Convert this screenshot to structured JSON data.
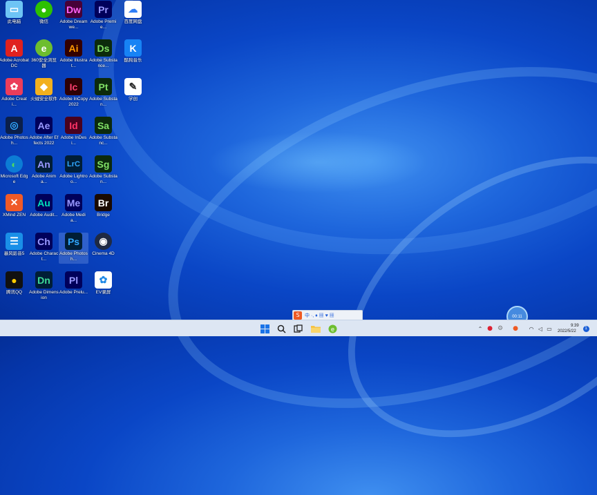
{
  "desktop_icons": [
    {
      "label": "此电脑",
      "glyph": "▭",
      "icon": "this-pc-icon",
      "bg": "#6ec4f5",
      "fg": "#ffffff"
    },
    {
      "label": "微信",
      "glyph": "●",
      "icon": "wechat-icon",
      "bg": "#2dc100",
      "fg": "#ffffff"
    },
    {
      "label": "Adobe Dreamwe...",
      "glyph": "Dw",
      "icon": "dreamweaver-icon",
      "bg": "#470137",
      "fg": "#ff61f6"
    },
    {
      "label": "Adobe Premie...",
      "glyph": "Pr",
      "icon": "premiere-icon",
      "bg": "#00005b",
      "fg": "#9999ff"
    },
    {
      "label": "百度网盘",
      "glyph": "☁",
      "icon": "baidu-netdisk-icon",
      "bg": "#ffffff",
      "fg": "#2f7ef7"
    },
    {
      "label": "Adobe Acrobat DC",
      "glyph": "A",
      "icon": "acrobat-icon",
      "bg": "#e0211f",
      "fg": "#ffffff"
    },
    {
      "label": "360安全浏览器",
      "glyph": "e",
      "icon": "360-browser-icon",
      "bg": "#6dbe2f",
      "fg": "#ffffff"
    },
    {
      "label": "Adobe Illustrat...",
      "glyph": "Ai",
      "icon": "illustrator-icon",
      "bg": "#330000",
      "fg": "#ff9a00"
    },
    {
      "label": "Adobe Substance...",
      "glyph": "Ds",
      "icon": "substance-designer-icon",
      "bg": "#0c2a0c",
      "fg": "#80e066"
    },
    {
      "label": "酷狗音乐",
      "glyph": "K",
      "icon": "kugou-icon",
      "bg": "#1783f5",
      "fg": "#ffffff"
    },
    {
      "label": "Adobe Creati...",
      "glyph": "✿",
      "icon": "creative-cloud-icon",
      "bg": "#ec3d5a",
      "fg": "#ffffff"
    },
    {
      "label": "火绒安全软件",
      "glyph": "◆",
      "icon": "huorong-icon",
      "bg": "#f2b01e",
      "fg": "#ffffff"
    },
    {
      "label": "Adobe InCopy 2022",
      "glyph": "Ic",
      "icon": "incopy-icon",
      "bg": "#2e0104",
      "fg": "#ff4170"
    },
    {
      "label": "Adobe Substan...",
      "glyph": "Pt",
      "icon": "substance-painter-icon",
      "bg": "#0c2a0c",
      "fg": "#80e066"
    },
    {
      "label": "学创",
      "glyph": "✎",
      "icon": "xuechuang-icon",
      "bg": "#ffffff",
      "fg": "#2a2a2a"
    },
    {
      "label": "Adobe Photosh...",
      "glyph": "◎",
      "icon": "photoshop-express-icon",
      "bg": "#0b1f4a",
      "fg": "#31a8ff"
    },
    {
      "label": "Adobe After Effects 2022",
      "glyph": "Ae",
      "icon": "after-effects-icon",
      "bg": "#00005b",
      "fg": "#9999ff"
    },
    {
      "label": "Adobe InDesi...",
      "glyph": "Id",
      "icon": "indesign-icon",
      "bg": "#49021f",
      "fg": "#ff3366"
    },
    {
      "label": "Adobe Substanc...",
      "glyph": "Sa",
      "icon": "substance-sampler-icon",
      "bg": "#0c2a0c",
      "fg": "#80e066"
    },
    {
      "label": "Microsoft Edge",
      "glyph": "◐",
      "icon": "edge-icon",
      "bg": "#0c7cd5",
      "fg": "#4cd964"
    },
    {
      "label": "Adobe Anima...",
      "glyph": "An",
      "icon": "animate-icon",
      "bg": "#001e36",
      "fg": "#9999ff"
    },
    {
      "label": "Adobe Lightroo...",
      "glyph": "LrC",
      "icon": "lightroom-classic-icon",
      "bg": "#001e36",
      "fg": "#31a8ff"
    },
    {
      "label": "Adobe Substan...",
      "glyph": "Sg",
      "icon": "substance-stager-icon",
      "bg": "#0c2a0c",
      "fg": "#80e066"
    },
    {
      "label": "XMind ZEN",
      "glyph": "✕",
      "icon": "xmind-icon",
      "bg": "#f05a28",
      "fg": "#ffffff"
    },
    {
      "label": "Adobe Audit...",
      "glyph": "Au",
      "icon": "audition-icon",
      "bg": "#00005b",
      "fg": "#00e4bb"
    },
    {
      "label": "Adobe Media...",
      "glyph": "Me",
      "icon": "media-encoder-icon",
      "bg": "#00005b",
      "fg": "#9999ff"
    },
    {
      "label": "Bridge",
      "glyph": "Br",
      "icon": "bridge-icon",
      "bg": "#1a0a00",
      "fg": "#ffffff"
    },
    {
      "label": "暴风影音5",
      "glyph": "☰",
      "icon": "baofeng-icon",
      "bg": "#1a8fe8",
      "fg": "#ffffff"
    },
    {
      "label": "Adobe Charact...",
      "glyph": "Ch",
      "icon": "character-animator-icon",
      "bg": "#00005b",
      "fg": "#9999ff"
    },
    {
      "label": "Adobe Photosh...",
      "glyph": "Ps",
      "icon": "photoshop-icon",
      "bg": "#001e36",
      "fg": "#31a8ff"
    },
    {
      "label": "Cinema 4D",
      "glyph": "◉",
      "icon": "cinema4d-icon",
      "bg": "#1f2a44",
      "fg": "#ffffff"
    },
    {
      "label": "腾讯QQ",
      "glyph": "●",
      "icon": "qq-icon",
      "bg": "#111111",
      "fg": "#ffcc00"
    },
    {
      "label": "Adobe Dimension",
      "glyph": "Dn",
      "icon": "dimension-icon",
      "bg": "#001e36",
      "fg": "#3ddc97"
    },
    {
      "label": "Adobe Prelu...",
      "glyph": "Pl",
      "icon": "prelude-icon",
      "bg": "#00005b",
      "fg": "#9999ff"
    },
    {
      "label": "EV录屏",
      "glyph": "✿",
      "icon": "ev-recorder-icon",
      "bg": "#ffffff",
      "fg": "#1e88e5"
    }
  ],
  "ime_toolbar": {
    "label": "中 ·, ♦ ▦ ♥ ▦"
  },
  "floating_bubble": {
    "label": "00:11"
  },
  "taskbar": {
    "start": "windows-icon",
    "search": "search-icon",
    "task_view": "task-view-icon",
    "explorer": "folder-icon",
    "browser": "360-browser-icon"
  },
  "clock": {
    "time": "9:39",
    "date": "2022/5/22"
  },
  "notification_count": "1",
  "colors": {
    "accent": "#1a5fd6",
    "taskbar": "#dde6f3"
  }
}
